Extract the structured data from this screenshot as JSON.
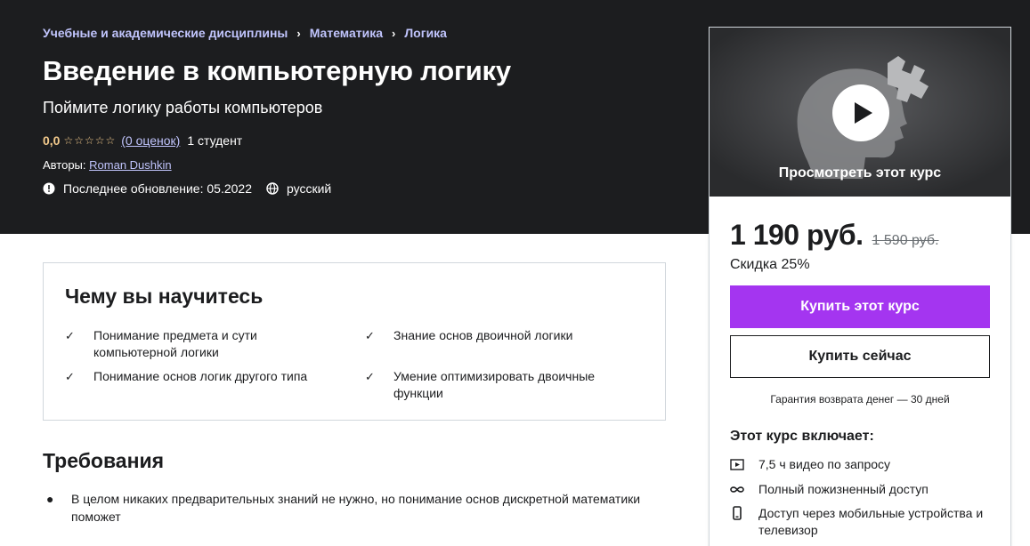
{
  "breadcrumb": [
    "Учебные и академические дисциплины",
    "Математика",
    "Логика"
  ],
  "course": {
    "title": "Введение в компьютерную логику",
    "subtitle": "Поймите логику работы компьютеров",
    "rating_score": "0,0",
    "rating_count": "(0 оценок)",
    "students": "1 студент",
    "authors_label": "Авторы:",
    "author": "Roman Dushkin",
    "updated": "Последнее обновление: 05.2022",
    "language": "русский"
  },
  "learn": {
    "title": "Чему вы научитесь",
    "items": [
      "Понимание предмета и сути компьютерной логики",
      "Знание основ двоичной логики",
      "Понимание основ логик другого типа",
      "Умение оптимизировать двоичные функции"
    ]
  },
  "requirements": {
    "title": "Требования",
    "items": [
      "В целом никаких предварительных знаний не нужно, но понимание основ дискретной математики поможет"
    ]
  },
  "sidebar": {
    "preview_caption": "Просмотреть этот курс",
    "price": "1 190 руб.",
    "old_price": "1 590 руб.",
    "discount": "Скидка 25%",
    "buy_label": "Купить этот курс",
    "buy_now_label": "Купить сейчас",
    "guarantee": "Гарантия возврата денег — 30 дней",
    "includes_title": "Этот курс включает:",
    "includes": [
      {
        "icon": "video-icon",
        "text": "7,5 ч видео по запросу"
      },
      {
        "icon": "infinity-icon",
        "text": "Полный пожизненный доступ"
      },
      {
        "icon": "mobile-icon",
        "text": "Доступ через мобильные устройства и телевизор"
      }
    ]
  },
  "colors": {
    "accent": "#a435f0",
    "hero_bg": "#1c1d1f",
    "link": "#c0c4fc",
    "star": "#f3ca8c"
  }
}
